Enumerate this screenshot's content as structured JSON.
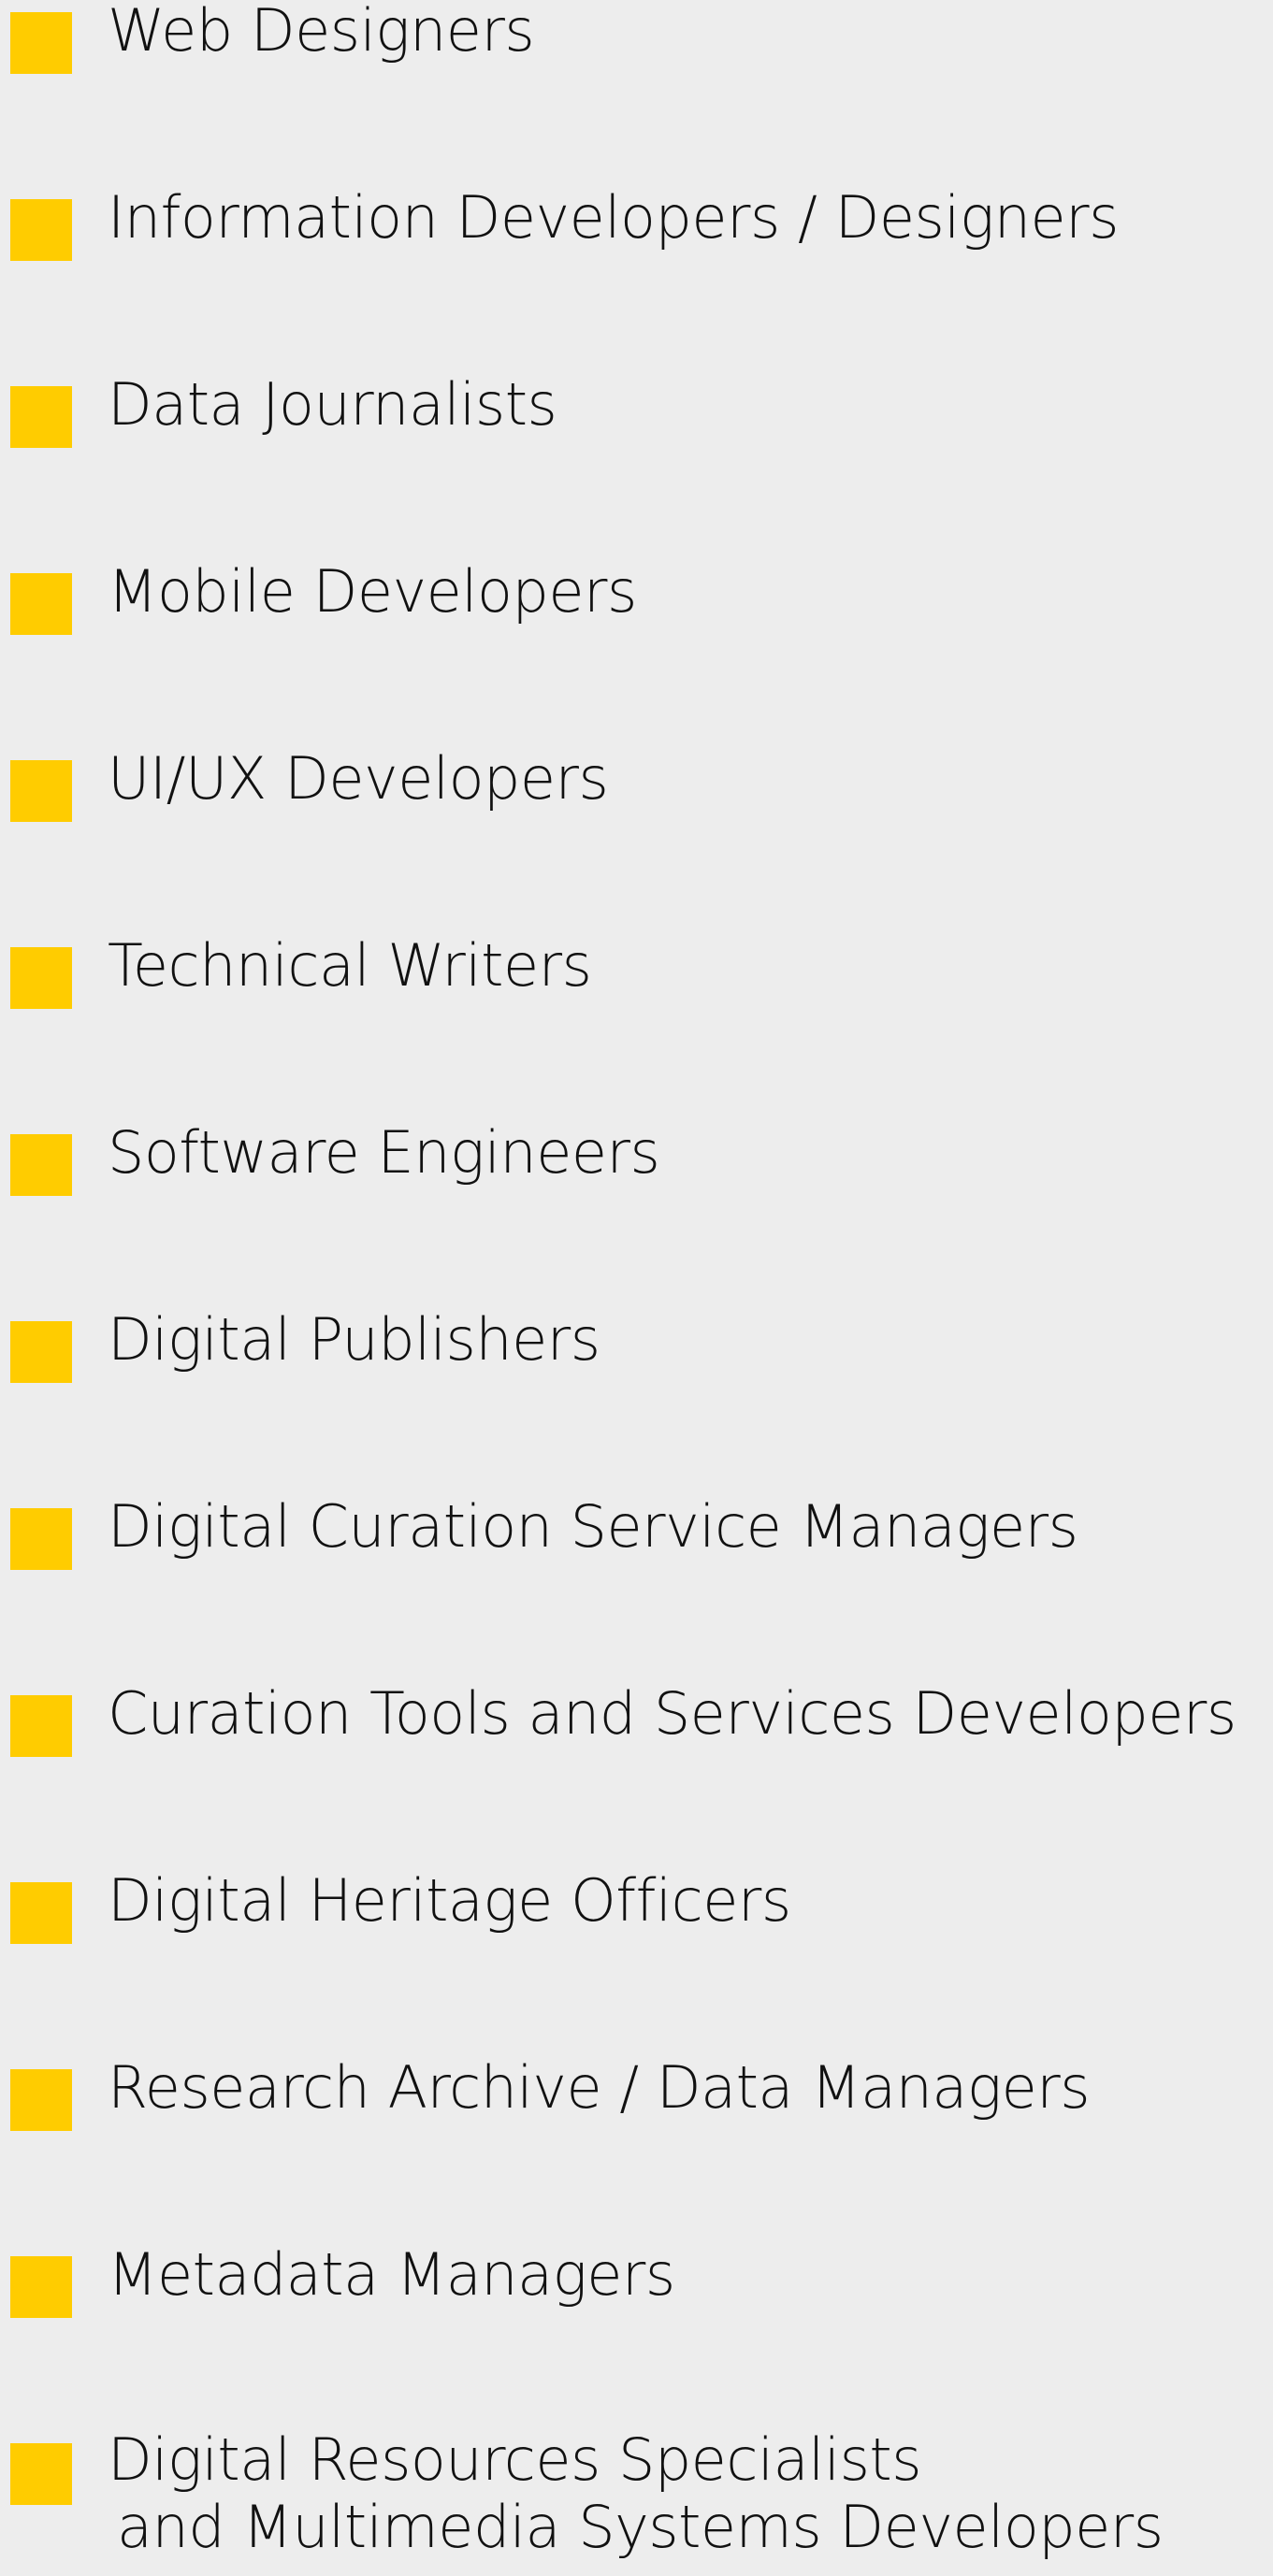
{
  "colors": {
    "background": "#ededed",
    "bullet": "#ffcc00",
    "text": "#111111"
  },
  "list": {
    "items": [
      {
        "label": "Web Designers"
      },
      {
        "label": "Information Developers / Designers"
      },
      {
        "label": "Data Journalists"
      },
      {
        "label": "Mobile Developers"
      },
      {
        "label": "UI/UX Developers"
      },
      {
        "label": "Technical Writers"
      },
      {
        "label": "Software Engineers"
      },
      {
        "label": "Digital Publishers"
      },
      {
        "label": "Digital Curation Service Managers"
      },
      {
        "label": "Curation Tools and Services Developers"
      },
      {
        "label": "Digital Heritage Officers"
      },
      {
        "label": "Research Archive / Data Managers"
      },
      {
        "label": "Metadata Managers"
      },
      {
        "label_line1": "Digital Resources Specialists",
        "label_line2": "and Multimedia Systems Developers"
      }
    ]
  }
}
